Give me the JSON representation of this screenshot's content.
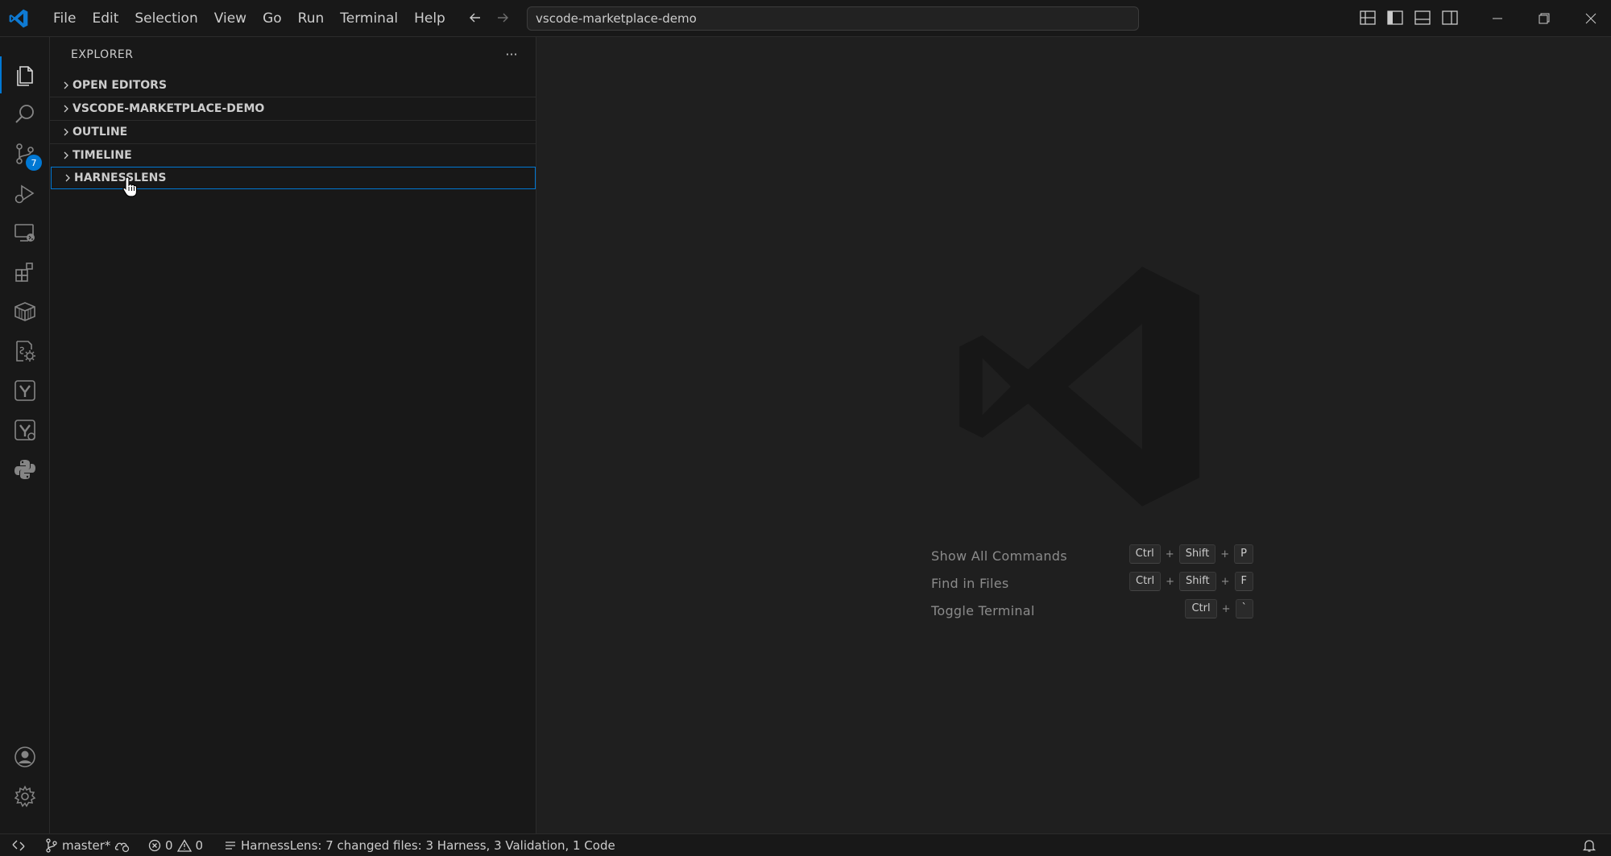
{
  "titlebar": {
    "menu": [
      "File",
      "Edit",
      "Selection",
      "View",
      "Go",
      "Run",
      "Terminal",
      "Help"
    ],
    "command_center": "vscode-marketplace-demo",
    "back_icon": "arrow-left-icon",
    "forward_icon": "arrow-right-icon"
  },
  "activitybar": {
    "items": [
      {
        "name": "explorer",
        "icon": "files-icon",
        "active": true
      },
      {
        "name": "search",
        "icon": "search-icon"
      },
      {
        "name": "source-control",
        "icon": "source-control-icon",
        "badge": "7"
      },
      {
        "name": "run-debug",
        "icon": "debug-icon"
      },
      {
        "name": "remote-explorer",
        "icon": "remote-explorer-icon"
      },
      {
        "name": "extensions",
        "icon": "extensions-icon"
      },
      {
        "name": "containers",
        "icon": "box-icon"
      },
      {
        "name": "settings-sync",
        "icon": "gear-doc-icon"
      },
      {
        "name": "harness",
        "icon": "harness-icon"
      },
      {
        "name": "harness-lens",
        "icon": "harness-lens-icon"
      },
      {
        "name": "python",
        "icon": "python-icon"
      }
    ],
    "bottom": [
      {
        "name": "accounts",
        "icon": "account-icon"
      },
      {
        "name": "manage",
        "icon": "gear-icon"
      }
    ]
  },
  "sidebar": {
    "title": "EXPLORER",
    "more": "···",
    "sections": [
      {
        "label": "OPEN EDITORS"
      },
      {
        "label": "VSCODE-MARKETPLACE-DEMO"
      },
      {
        "label": "OUTLINE"
      },
      {
        "label": "TIMELINE"
      },
      {
        "label": "HARNESSLENS"
      }
    ]
  },
  "editor": {
    "shortcuts": [
      {
        "label": "Show All Commands",
        "keys": [
          "Ctrl",
          "Shift",
          "P"
        ]
      },
      {
        "label": "Find in Files",
        "keys": [
          "Ctrl",
          "Shift",
          "F"
        ]
      },
      {
        "label": "Toggle Terminal",
        "keys": [
          "Ctrl",
          "`"
        ]
      }
    ]
  },
  "statusbar": {
    "branch": "master*",
    "errors": "0",
    "warnings": "0",
    "harness_status": "HarnessLens: 7 changed files: 3 Harness, 3 Validation, 1 Code"
  },
  "colors": {
    "accent": "#0078d4",
    "background": "#181818",
    "editor_background": "#1f1f1f",
    "text": "#cccccc"
  }
}
